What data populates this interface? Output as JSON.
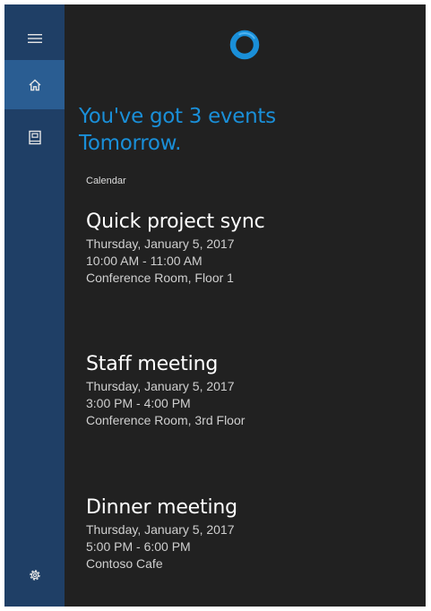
{
  "app": {
    "accent": "#1a8fd8",
    "sidebar_bg": "#1f3f66",
    "sidebar_active_bg": "#2a5d92",
    "panel_bg": "#212121"
  },
  "sidebar": {
    "items": [
      {
        "name": "menu",
        "icon": "hamburger-menu-icon"
      },
      {
        "name": "home",
        "icon": "home-icon",
        "active": true
      },
      {
        "name": "notebook",
        "icon": "notebook-icon"
      },
      {
        "name": "settings",
        "icon": "gear-icon"
      }
    ]
  },
  "cortana": {
    "icon": "cortana-ring-icon",
    "headline_line1": "You've got 3 events",
    "headline_line2": "Tomorrow."
  },
  "calendar": {
    "source_label": "Calendar",
    "events": [
      {
        "title": "Quick project sync",
        "date": "Thursday, January 5, 2017",
        "time": "10:00 AM - 11:00 AM",
        "location": "Conference Room, Floor 1"
      },
      {
        "title": "Staff meeting",
        "date": "Thursday, January 5, 2017",
        "time": "3:00 PM - 4:00 PM",
        "location": "Conference Room, 3rd Floor"
      },
      {
        "title": "Dinner meeting",
        "date": "Thursday, January 5, 2017",
        "time": "5:00 PM - 6:00 PM",
        "location": "Contoso Cafe"
      }
    ]
  }
}
